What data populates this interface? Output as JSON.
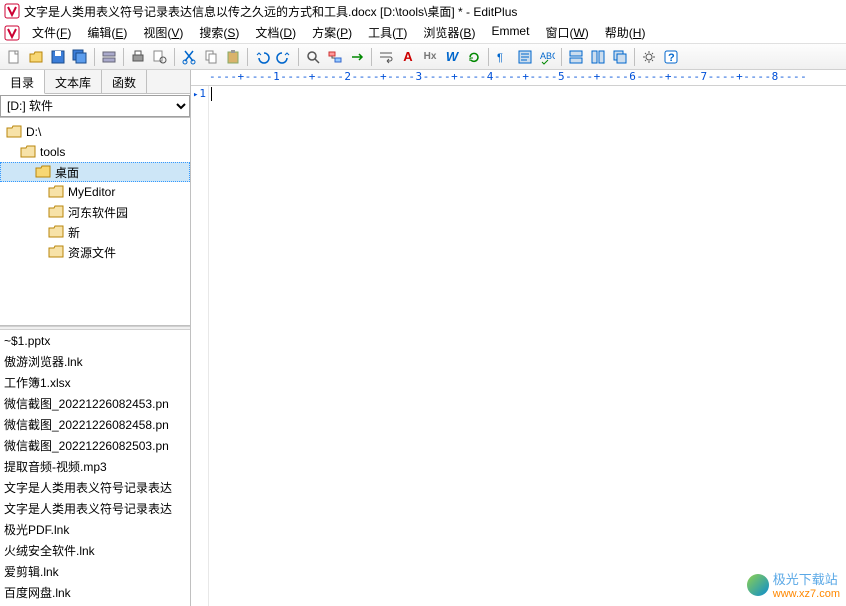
{
  "title": "文字是人类用表义符号记录表达信息以传之久远的方式和工具.docx [D:\\tools\\桌面] * - EditPlus",
  "menus": [
    {
      "label": "文件(",
      "u": "F",
      "tail": ")"
    },
    {
      "label": "编辑(",
      "u": "E",
      "tail": ")"
    },
    {
      "label": "视图(",
      "u": "V",
      "tail": ")"
    },
    {
      "label": "搜索(",
      "u": "S",
      "tail": ")"
    },
    {
      "label": "文档(",
      "u": "D",
      "tail": ")"
    },
    {
      "label": "方案(",
      "u": "P",
      "tail": ")"
    },
    {
      "label": "工具(",
      "u": "T",
      "tail": ")"
    },
    {
      "label": "浏览器(",
      "u": "B",
      "tail": ")"
    },
    {
      "label": "Emmet",
      "u": "",
      "tail": ""
    },
    {
      "label": "窗口(",
      "u": "W",
      "tail": ")"
    },
    {
      "label": "帮助(",
      "u": "H",
      "tail": ")"
    }
  ],
  "sideTabs": {
    "dir": "目录",
    "text": "文本库",
    "func": "函数"
  },
  "driveLabel": "[D:] 软件",
  "folders": [
    {
      "name": "D:\\",
      "indent": 0,
      "sel": false
    },
    {
      "name": "tools",
      "indent": 1,
      "sel": false
    },
    {
      "name": "桌面",
      "indent": 2,
      "sel": true
    },
    {
      "name": "MyEditor",
      "indent": 3,
      "sel": false
    },
    {
      "name": "河东软件园",
      "indent": 3,
      "sel": false
    },
    {
      "name": "新",
      "indent": 3,
      "sel": false
    },
    {
      "name": "资源文件",
      "indent": 3,
      "sel": false
    }
  ],
  "files": [
    "~$1.pptx",
    "傲游浏览器.lnk",
    "工作簿1.xlsx",
    "微信截图_20221226082453.pn",
    "微信截图_20221226082458.pn",
    "微信截图_20221226082503.pn",
    "提取音频-视频.mp3",
    "文字是人类用表义符号记录表达",
    "文字是人类用表义符号记录表达",
    "极光PDF.lnk",
    "火绒安全软件.lnk",
    "爱剪辑.lnk",
    "百度网盘.lnk"
  ],
  "ruler": "----+----1----+----2----+----3----+----4----+----5----+----6----+----7----+----8----",
  "gutterLine": "1",
  "watermark": {
    "name": "极光下载站",
    "url": "www.xz7.com"
  }
}
